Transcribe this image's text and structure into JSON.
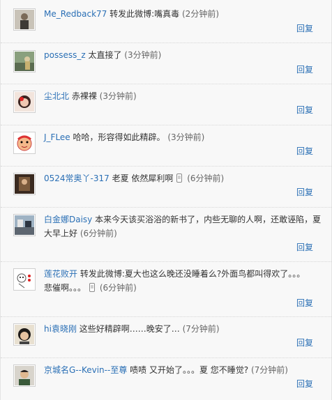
{
  "comments": [
    {
      "user": "Me_Redback77",
      "text": " 转发此微博:嘴真毒",
      "time": " (2分钟前)",
      "reply": "回复",
      "avatar_icon": "avatar-photo-person-icon"
    },
    {
      "user": "possess_z",
      "text": " 太直接了",
      "time": " (3分钟前)",
      "reply": "回复",
      "avatar_icon": "avatar-photo-street-icon"
    },
    {
      "user": "尘北北",
      "text": " 赤裸裸",
      "time": " (3分钟前)",
      "reply": "回复",
      "avatar_icon": "avatar-photo-girl-icon"
    },
    {
      "user": "J_FLee",
      "text": " 哈哈，形容得如此精辟。",
      "time": " (3分钟前)",
      "reply": "回复",
      "avatar_icon": "avatar-cartoon-face-icon"
    },
    {
      "user": "0524常奥丫-317",
      "text": " 老夏  依然犀利啊",
      "time": " (6分钟前)",
      "reply": "回复",
      "avatar_icon": "avatar-photo-dark-icon",
      "mobile": true
    },
    {
      "user": "白金娜Daisy",
      "text": " 本来今天该买浴浴的新书了，内些无聊的人啊，还敢诬陷，夏大早上好",
      "time": " (6分钟前)",
      "reply": "回复",
      "avatar_icon": "avatar-photo-room-icon"
    },
    {
      "user": "莲花败开",
      "text": "  转发此微博:夏大也这么晚还没睡着么?外面鸟都叫得欢了。。。悲催啊。。。",
      "time": " (6分钟前)",
      "reply": "回复",
      "avatar_icon": "avatar-sketch-icon",
      "mobile": true
    },
    {
      "user": "hi袁晓刚",
      "text": " 这些好精辟啊……晚安了…",
      "time": " (7分钟前)",
      "reply": "回复",
      "avatar_icon": "avatar-photo-boy-icon"
    },
    {
      "user": "京城名G--Kevin--至尊",
      "text": "  啧啧  又开始了。。。夏  您不睡觉?",
      "time": " (7分钟前)",
      "reply": "回复",
      "avatar_icon": "avatar-photo-man-icon"
    }
  ]
}
